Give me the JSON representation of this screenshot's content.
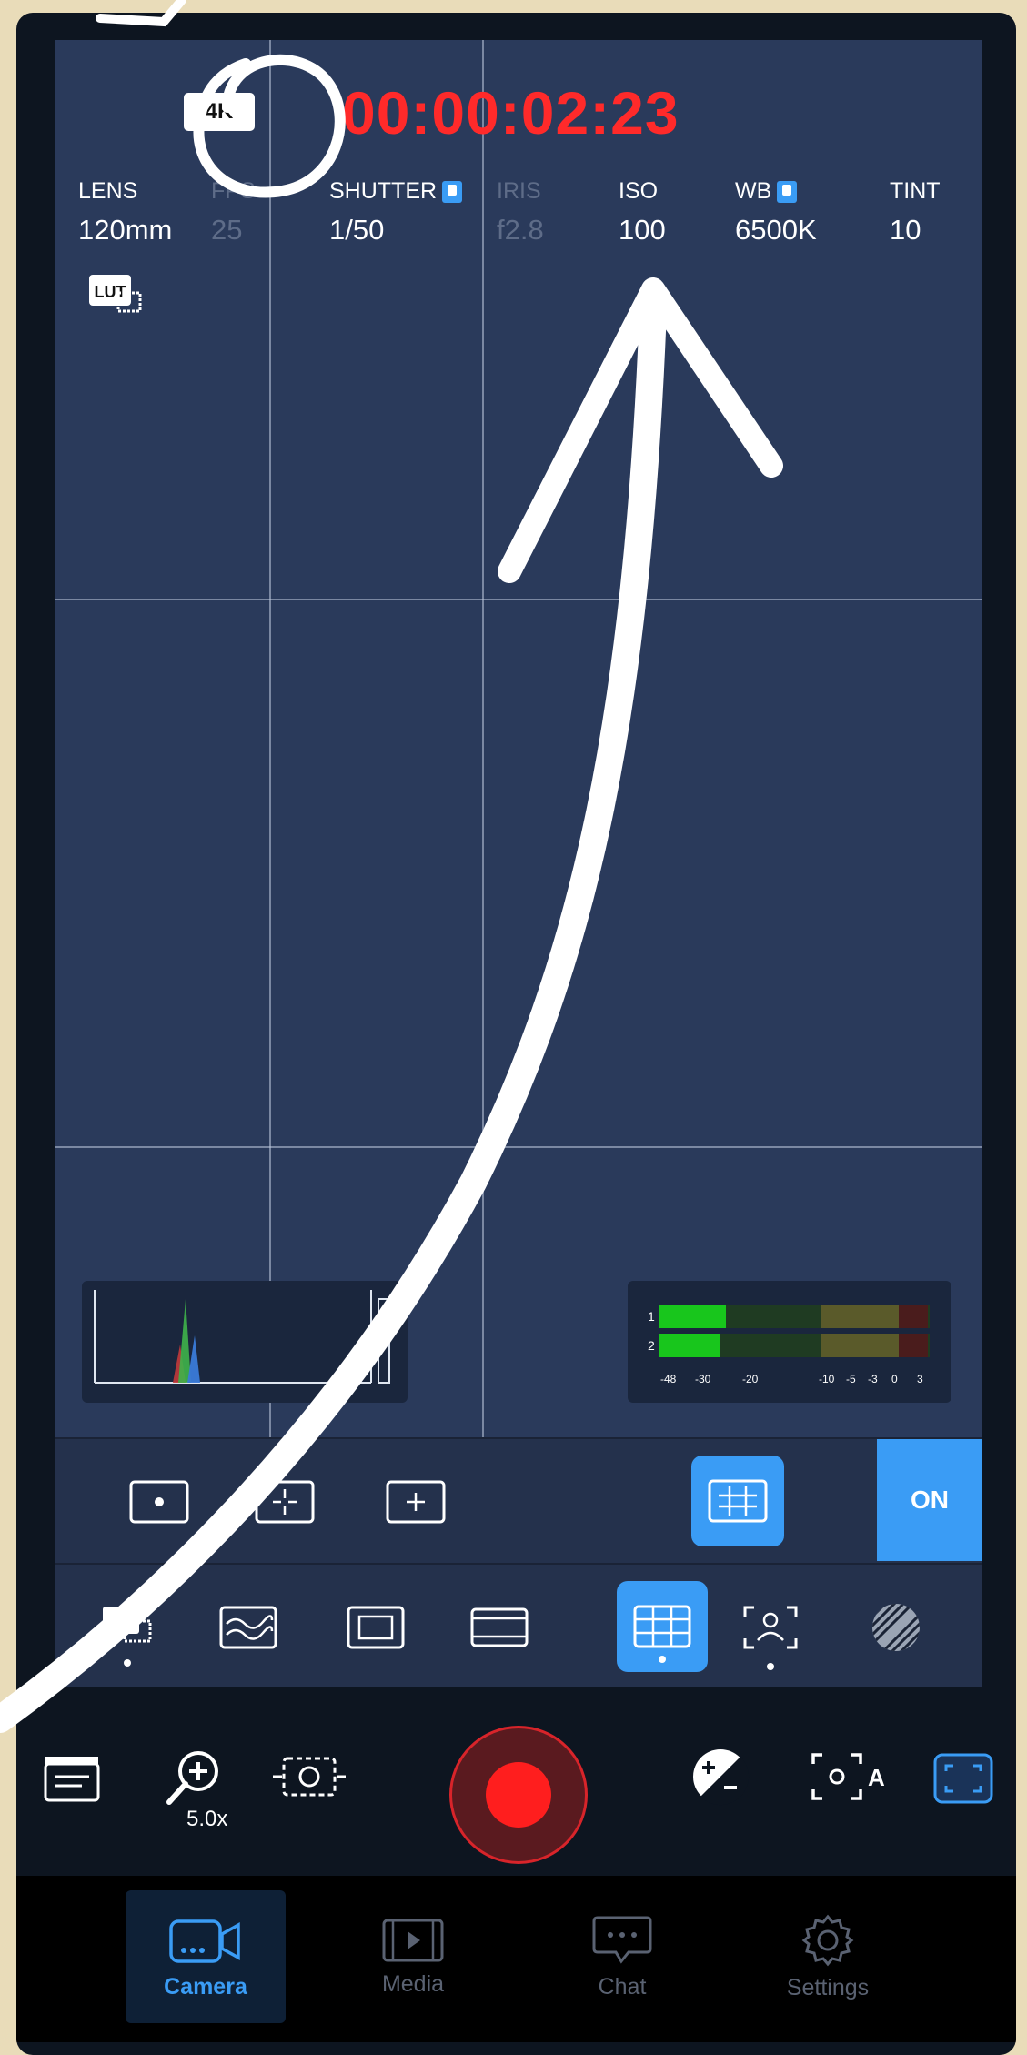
{
  "header": {
    "resolution_badge": "4K",
    "timecode": "00:00:02:23"
  },
  "params": [
    {
      "label": "LENS",
      "value": "120mm",
      "locked": false,
      "dim": false
    },
    {
      "label": "FPS",
      "value": "25",
      "locked": false,
      "dim": true
    },
    {
      "label": "SHUTTER",
      "value": "1/50",
      "locked": true,
      "dim": false
    },
    {
      "label": "IRIS",
      "value": "f2.8",
      "locked": false,
      "dim": true
    },
    {
      "label": "ISO",
      "value": "100",
      "locked": false,
      "dim": false
    },
    {
      "label": "WB",
      "value": "6500K",
      "locked": true,
      "dim": false
    },
    {
      "label": "TINT",
      "value": "10",
      "locked": false,
      "dim": false
    }
  ],
  "lut_badge": "LUT",
  "audio_meter": {
    "channels": [
      "1",
      "2"
    ],
    "scale": [
      "-48",
      "-30",
      "-20",
      "-10",
      "-5",
      "-3",
      "0",
      "3"
    ],
    "levels": [
      0.22,
      0.2
    ]
  },
  "guide_toolbar": {
    "toggle_label": "ON",
    "items": [
      "center-dot-guide-icon",
      "crosshair-guide-icon",
      "plus-guide-icon",
      "grid-guide-icon"
    ],
    "active_index": 3
  },
  "tool_toolbar": {
    "items": [
      "lut-icon",
      "waveform-icon",
      "frame-guide-icon",
      "aspect-ratio-icon",
      "grid-icon",
      "face-detect-icon",
      "zebra-icon"
    ],
    "active_index": 4
  },
  "controls": {
    "zoom_value": "5.0x",
    "record_state": "recording"
  },
  "tabs": [
    {
      "label": "Camera",
      "icon": "camera-icon",
      "active": true
    },
    {
      "label": "Media",
      "icon": "media-icon",
      "active": false
    },
    {
      "label": "Chat",
      "icon": "chat-icon",
      "active": false
    },
    {
      "label": "Settings",
      "icon": "settings-icon",
      "active": false
    }
  ],
  "colors": {
    "accent": "#3a9cf5",
    "timecode": "#ff2a2a",
    "record": "#ff1e1e"
  }
}
